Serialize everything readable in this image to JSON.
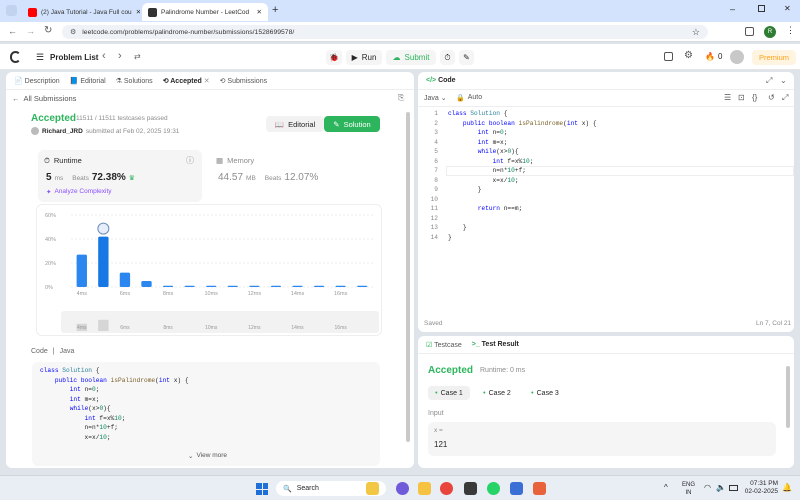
{
  "browser": {
    "tabs": [
      {
        "title": "(2) Java Tutorial - Java Full cou"
      },
      {
        "title": "Palindrome Number - LeetCod"
      }
    ],
    "url": "leetcode.com/problems/palindrome-number/submissions/1528699578/",
    "profile_initial": "R"
  },
  "toolbar": {
    "problem_list": "Problem List",
    "run": "Run",
    "submit": "Submit",
    "coins": "0",
    "premium": "Premium"
  },
  "left_tabs": [
    {
      "label": "Description"
    },
    {
      "label": "Editorial"
    },
    {
      "label": "Solutions"
    },
    {
      "label": "Accepted"
    },
    {
      "label": "Submissions"
    }
  ],
  "submission": {
    "back": "All Submissions",
    "status": "Accepted",
    "passed": "11511 / 11511 testcases passed",
    "user": "Richard_JRD",
    "submitted": "submitted at Feb 02, 2025 19:31",
    "editorial_btn": "Editorial",
    "solution_btn": "Solution",
    "runtime_label": "Runtime",
    "runtime_value": "5",
    "runtime_unit": "ms",
    "beats_label": "Beats",
    "runtime_beats": "72.38%",
    "analyze": "Analyze Complexity",
    "memory_label": "Memory",
    "memory_value": "44.57",
    "memory_unit": "MB",
    "memory_beats": "12.07%"
  },
  "chart_data": {
    "type": "bar",
    "y_ticks": [
      "60%",
      "40%",
      "20%",
      "0%"
    ],
    "ylim": [
      0,
      60
    ],
    "values": [
      27,
      42,
      12,
      5,
      1,
      1,
      1,
      1,
      1,
      1,
      1,
      1,
      1,
      1
    ],
    "highlight_index": 1,
    "x_labels": [
      "4ms",
      "6ms",
      "8ms",
      "10ms",
      "12ms",
      "14ms",
      "16ms"
    ],
    "mini_labels": [
      "4ms",
      "6ms",
      "8ms",
      "10ms",
      "12ms",
      "14ms",
      "16ms"
    ]
  },
  "code_section": {
    "label": "Code",
    "lang": "Java",
    "view_more": "View more"
  },
  "left_code": [
    "class Solution {",
    "    public boolean isPalindrome(int x) {",
    "        int n=0;",
    "        int m=x;",
    "        while(x>0){",
    "            int f=x%10;",
    "            n=n*10+f;",
    "            x=x/10;"
  ],
  "editor": {
    "title": "Code",
    "lang": "Java",
    "mode": "Auto",
    "saved": "Saved",
    "cursor": "Ln 7, Col 21"
  },
  "editor_lines": [
    "class Solution {",
    "    public boolean isPalindrome(int x) {",
    "        int n=0;",
    "        int m=x;",
    "        while(x>0){",
    "            int f=x%10;",
    "            n=n*10+f;",
    "            x=x/10;",
    "        }",
    "",
    "        return n==m;",
    "",
    "    }",
    "}"
  ],
  "testpanel": {
    "tab_testcase": "Testcase",
    "tab_result": "Test Result",
    "status": "Accepted",
    "runtime": "Runtime: 0 ms",
    "cases": [
      "Case 1",
      "Case 2",
      "Case 3"
    ],
    "input_label": "Input",
    "var_name": "x =",
    "var_value": "121"
  },
  "taskbar": {
    "search": "Search",
    "lang1": "ENG",
    "lang2": "IN",
    "time": "07:31 PM",
    "date": "02-02-2025"
  },
  "colors": {
    "accent_green": "#2db55d",
    "bar_blue": "#1677e5",
    "leetcode_orange": "#ffa116"
  }
}
